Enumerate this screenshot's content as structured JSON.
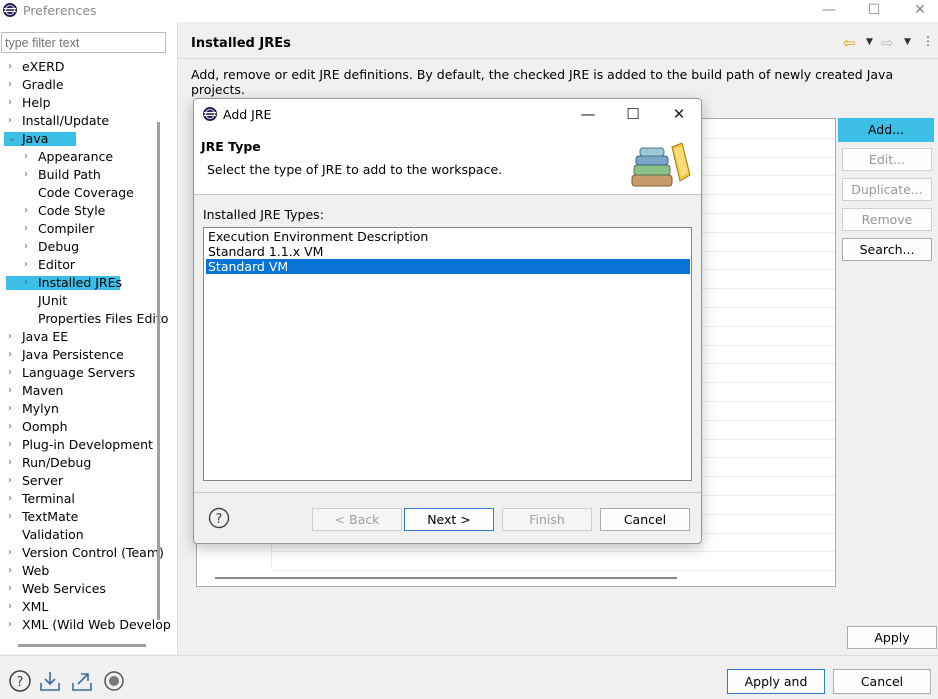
{
  "window": {
    "title": "Preferences",
    "min_glyph": "—",
    "max_glyph": "☐",
    "close_glyph": "✕"
  },
  "filter": {
    "placeholder": "type filter text"
  },
  "tree": {
    "items": [
      {
        "label": "eXERD",
        "expand": "›"
      },
      {
        "label": "Gradle",
        "expand": "›"
      },
      {
        "label": "Help",
        "expand": "›"
      },
      {
        "label": "Install/Update",
        "expand": "›"
      },
      {
        "label": "Java",
        "expand": "⌄"
      },
      {
        "label": "Appearance",
        "expand": "›"
      },
      {
        "label": "Build Path",
        "expand": "›"
      },
      {
        "label": "Code Coverage",
        "expand": ""
      },
      {
        "label": "Code Style",
        "expand": "›"
      },
      {
        "label": "Compiler",
        "expand": "›"
      },
      {
        "label": "Debug",
        "expand": "›"
      },
      {
        "label": "Editor",
        "expand": "›"
      },
      {
        "label": "Installed JREs",
        "expand": "›"
      },
      {
        "label": "JUnit",
        "expand": ""
      },
      {
        "label": "Properties Files Edito",
        "expand": ""
      },
      {
        "label": "Java EE",
        "expand": "›"
      },
      {
        "label": "Java Persistence",
        "expand": "›"
      },
      {
        "label": "Language Servers",
        "expand": "›"
      },
      {
        "label": "Maven",
        "expand": "›"
      },
      {
        "label": "Mylyn",
        "expand": "›"
      },
      {
        "label": "Oomph",
        "expand": "›"
      },
      {
        "label": "Plug-in Development",
        "expand": "›"
      },
      {
        "label": "Run/Debug",
        "expand": "›"
      },
      {
        "label": "Server",
        "expand": "›"
      },
      {
        "label": "Terminal",
        "expand": "›"
      },
      {
        "label": "TextMate",
        "expand": "›"
      },
      {
        "label": "Validation",
        "expand": ""
      },
      {
        "label": "Version Control (Team)",
        "expand": "›"
      },
      {
        "label": "Web",
        "expand": "›"
      },
      {
        "label": "Web Services",
        "expand": "›"
      },
      {
        "label": "XML",
        "expand": "›"
      },
      {
        "label": "XML (Wild Web Develop",
        "expand": "›"
      }
    ]
  },
  "page": {
    "title": "Installed JREs",
    "description": "Add, remove or edit JRE definitions. By default, the checked JRE is added to the build path of newly created Java projects.",
    "nav": {
      "back": "⇦",
      "forward": "⇨",
      "menu": "▼",
      "more": "⋮"
    }
  },
  "side_buttons": {
    "add": "Add...",
    "edit": "Edit...",
    "duplicate": "Duplicate...",
    "remove": "Remove",
    "search": "Search..."
  },
  "apply_label": "Apply",
  "footer": {
    "apply_close": "Apply and Close",
    "cancel": "Cancel"
  },
  "dialog": {
    "title": "Add JRE",
    "heading": "JRE Type",
    "message": "Select the type of JRE to add to the workspace.",
    "types_label": "Installed JRE Types:",
    "types": [
      "Execution Environment Description",
      "Standard 1.1.x VM",
      "Standard VM"
    ],
    "selected_type": "Standard VM",
    "buttons": {
      "back": "< Back",
      "next": "Next >",
      "finish": "Finish",
      "cancel": "Cancel"
    }
  },
  "colors": {
    "highlight": "#3bbfe6",
    "selection": "#0a74d6"
  }
}
